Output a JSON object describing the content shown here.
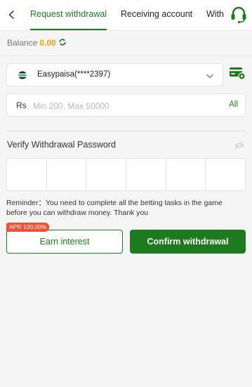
{
  "header": {
    "tabs": [
      {
        "label": "Request withdrawal",
        "active": true
      },
      {
        "label": "Receiving account",
        "active": false
      },
      {
        "label": "With",
        "active": false
      }
    ]
  },
  "balance": {
    "label": "Balance",
    "amount": "0.00"
  },
  "account": {
    "name": "Easypaisa(****2397)"
  },
  "amount": {
    "currency": "Rs",
    "placeholder": "Min 200, Max 50000",
    "value": "",
    "all_label": "All"
  },
  "password": {
    "label": "Verify Withdrawal Password",
    "digits": [
      "",
      "",
      "",
      "",
      "",
      ""
    ]
  },
  "reminder": "Reminder：You need to complete all the betting tasks in the game before you can withdraw money. Thank you",
  "actions": {
    "apr_badge": "APR 100.00%",
    "earn_label": "Earn interest",
    "confirm_label": "Confirm withdrawal"
  },
  "colors": {
    "accent": "#1e7a1e",
    "balance": "#f0a000",
    "badge": "#ef5136"
  }
}
